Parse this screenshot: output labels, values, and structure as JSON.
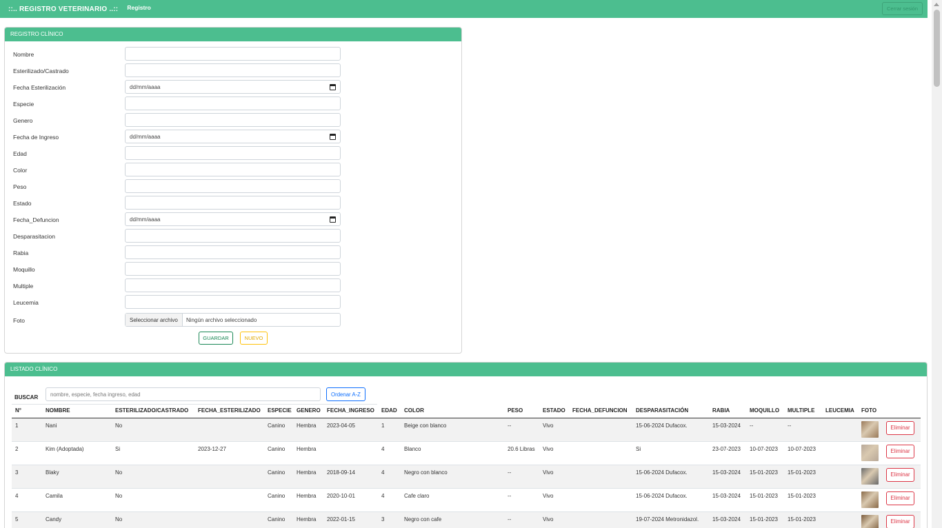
{
  "navbar": {
    "brand": "::.. REGISTRO VETERINARIO ..::",
    "link": "Registro",
    "logout": "Cerrar sesión"
  },
  "form": {
    "header": "REGISTRO CLÍNICO",
    "fields": [
      {
        "label": "Nombre",
        "type": "text",
        "value": ""
      },
      {
        "label": "Esterilizado/Castrado",
        "type": "text",
        "value": ""
      },
      {
        "label": "Fecha Esterilización",
        "type": "date",
        "value": "dd/mm/aaaa"
      },
      {
        "label": "Especie",
        "type": "text",
        "value": ""
      },
      {
        "label": "Genero",
        "type": "text",
        "value": ""
      },
      {
        "label": "Fecha de Ingreso",
        "type": "date",
        "value": "dd/mm/aaaa"
      },
      {
        "label": "Edad",
        "type": "text",
        "value": ""
      },
      {
        "label": "Color",
        "type": "text",
        "value": ""
      },
      {
        "label": "Peso",
        "type": "text",
        "value": ""
      },
      {
        "label": "Estado",
        "type": "text",
        "value": ""
      },
      {
        "label": "Fecha_Defuncion",
        "type": "date",
        "value": "dd/mm/aaaa"
      },
      {
        "label": "Desparasitacion",
        "type": "text",
        "value": ""
      },
      {
        "label": "Rabia",
        "type": "text",
        "value": ""
      },
      {
        "label": "Moquillo",
        "type": "text",
        "value": ""
      },
      {
        "label": "Multiple",
        "type": "text",
        "value": ""
      },
      {
        "label": "Leucemia",
        "type": "text",
        "value": ""
      }
    ],
    "photo": {
      "label": "Foto",
      "button": "Seleccionar archivo",
      "status": "Ningún archivo seleccionado"
    },
    "save": "GUARDAR",
    "new": "NUEVO"
  },
  "list": {
    "header": "LISTADO CLÍNICO",
    "search_label": "BUSCAR",
    "search_placeholder": "nombre, especie, fecha ingreso, edad",
    "sort_button": "Ordenar A-Z",
    "delete_label": "Eliminar",
    "columns": [
      "N°",
      "NOMBRE",
      "ESTERILIZADO/CASTRADO",
      "FECHA_ESTERILIZADO",
      "ESPECIE",
      "GENERO",
      "FECHA_INGRESO",
      "EDAD",
      "COLOR",
      "PESO",
      "ESTADO",
      "FECHA_DEFUNCION",
      "DESPARASITACIÓN",
      "RABIA",
      "MOQUILLO",
      "MULTIPLE",
      "LEUCEMIA",
      "FOTO"
    ],
    "rows": [
      {
        "cells": [
          "1",
          "Nani",
          "No",
          "",
          "Canino",
          "Hembra",
          "2023-04-05",
          "1",
          "Beige con blanco",
          "--",
          "Vivo",
          "",
          "15-06-2024 Dufacox.",
          "15-03-2024",
          "--",
          "--",
          ""
        ],
        "photo_color": "#9a7a5a"
      },
      {
        "cells": [
          "2",
          "Kim (Adoptada)",
          "Si",
          "2023-12-27",
          "Canino",
          "Hembra",
          "",
          "4",
          "Blanco",
          "20.6 Libras",
          "Vivo",
          "",
          "Si",
          "23-07-2023",
          "10-07-2023",
          "10-07-2023",
          ""
        ],
        "photo_color": "#b8a898"
      },
      {
        "cells": [
          "3",
          "Blaky",
          "No",
          "",
          "Canino",
          "Hembra",
          "2018-09-14",
          "4",
          "Negro con blanco",
          "--",
          "Vivo",
          "",
          "15-06-2024 Dufacox.",
          "15-03-2024",
          "15-01-2023",
          "15-01-2023",
          ""
        ],
        "photo_color": "#6a6a6a"
      },
      {
        "cells": [
          "4",
          "Camila",
          "No",
          "",
          "Canino",
          "Hembra",
          "2020-10-01",
          "4",
          "Cafe claro",
          "--",
          "Vivo",
          "",
          "15-06-2024 Dufacox.",
          "15-03-2024",
          "15-01-2023",
          "15-01-2023",
          ""
        ],
        "photo_color": "#8a6a48"
      },
      {
        "cells": [
          "5",
          "Candy",
          "No",
          "",
          "Canino",
          "Hembra",
          "2022-01-15",
          "3",
          "Negro con cafe",
          "--",
          "Vivo",
          "",
          "19-07-2024 Metronidazol.",
          "15-03-2024",
          "15-01-2023",
          "15-01-2023",
          ""
        ],
        "photo_color": "#7a5a3a"
      }
    ]
  }
}
